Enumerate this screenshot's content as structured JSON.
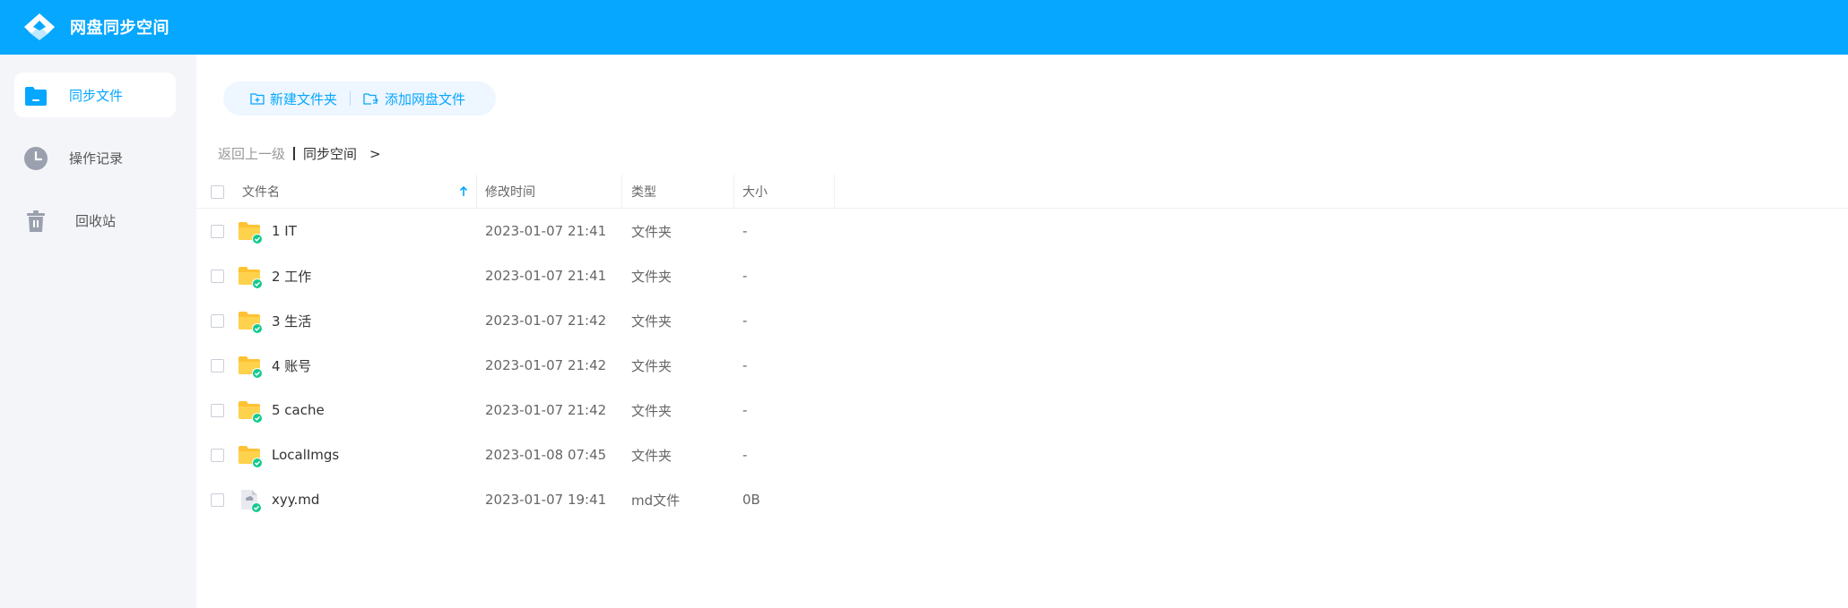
{
  "header": {
    "title": "网盘同步空间"
  },
  "sidebar": {
    "items": [
      {
        "label": "同步文件",
        "icon": "folder-icon",
        "active": true
      },
      {
        "label": "操作记录",
        "icon": "clock-icon",
        "active": false
      },
      {
        "label": "回收站",
        "icon": "trash-icon",
        "active": false
      }
    ]
  },
  "toolbar": {
    "new_folder_label": "新建文件夹",
    "add_file_label": "添加网盘文件"
  },
  "breadcrumb": {
    "back_label": "返回上一级",
    "current": "同步空间",
    "arrow": ">"
  },
  "table": {
    "columns": {
      "name": "文件名",
      "modified": "修改时间",
      "type": "类型",
      "size": "大小"
    },
    "sort": {
      "column": "name",
      "direction": "ascending"
    },
    "rows": [
      {
        "name": "1 IT",
        "modified": "2023-01-07 21:41",
        "type": "文件夹",
        "size": "-",
        "icon": "synced-folder-icon"
      },
      {
        "name": "2 工作",
        "modified": "2023-01-07 21:41",
        "type": "文件夹",
        "size": "-",
        "icon": "synced-folder-icon"
      },
      {
        "name": "3 生活",
        "modified": "2023-01-07 21:42",
        "type": "文件夹",
        "size": "-",
        "icon": "synced-folder-icon"
      },
      {
        "name": "4 账号",
        "modified": "2023-01-07 21:42",
        "type": "文件夹",
        "size": "-",
        "icon": "synced-folder-icon"
      },
      {
        "name": "5 cache",
        "modified": "2023-01-07 21:42",
        "type": "文件夹",
        "size": "-",
        "icon": "synced-folder-icon"
      },
      {
        "name": "LocalImgs",
        "modified": "2023-01-08 07:45",
        "type": "文件夹",
        "size": "-",
        "icon": "synced-folder-icon"
      },
      {
        "name": "xyy.md",
        "modified": "2023-01-07 19:41",
        "type": "md文件",
        "size": "0B",
        "icon": "synced-file-icon"
      }
    ]
  },
  "colors": {
    "accent": "#06a7ff",
    "sidebar_bg": "#f4f5f8",
    "folder": "#ffc233",
    "sync_badge": "#14c98f"
  }
}
